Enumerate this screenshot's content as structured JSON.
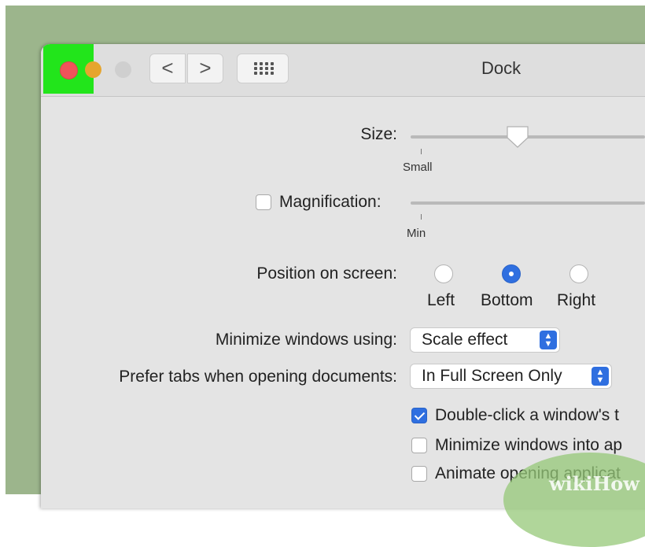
{
  "window": {
    "title": "Dock"
  },
  "toolbar": {
    "back": "<",
    "forward": ">"
  },
  "settings": {
    "size": {
      "label": "Size:",
      "min_label": "Small",
      "value": 0.38
    },
    "magnification": {
      "label": "Magnification:",
      "min_label": "Min",
      "checked": false
    },
    "position": {
      "label": "Position on screen:",
      "options": [
        "Left",
        "Bottom",
        "Right"
      ],
      "selected": "Bottom"
    },
    "minimize": {
      "label": "Minimize windows using:",
      "value": "Scale effect"
    },
    "prefer_tabs": {
      "label": "Prefer tabs when opening documents:",
      "value": "In Full Screen Only"
    },
    "checkboxes": [
      {
        "label": "Double-click a window's t",
        "checked": true
      },
      {
        "label": "Minimize windows into ap",
        "checked": false
      },
      {
        "label": "Animate opening applicat",
        "checked": false
      }
    ]
  },
  "watermark": "wikiHow",
  "colors": {
    "accent": "#2f6fe0",
    "highlight": "#22e51b",
    "close": "#f0535a"
  }
}
